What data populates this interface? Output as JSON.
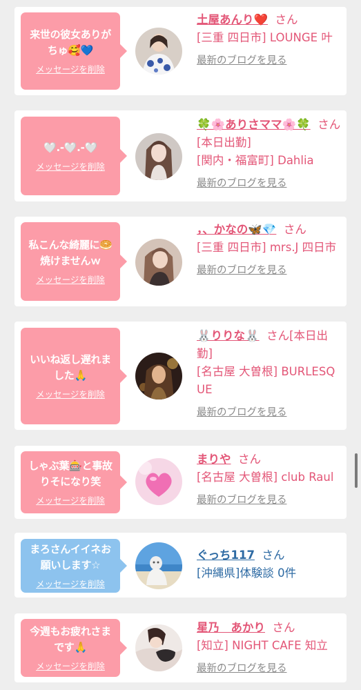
{
  "messages": [
    {
      "bubble": "来世の彼女ありがちゅ🥰💙",
      "delete": "メッセージを削除",
      "name": "土屋あんり❤️",
      "honorific": "さん",
      "shop": "[三重 四日市] LOUNGE 叶",
      "blog": "最新のブログを見る",
      "color": "pink",
      "avatar": "avatar-woman-blue-floral-icon"
    },
    {
      "bubble": "🤍.-🤍.-🤍",
      "delete": "メッセージを削除",
      "name": "🍀🌸ありさママ🌸🍀",
      "honorific": "さん[本日出勤]",
      "shop": "[関内・福富町] Dahlia",
      "blog": "最新のブログを見る",
      "color": "pink",
      "avatar": "avatar-woman-long-hair-icon"
    },
    {
      "bubble": "私こんな綺麗に🥯焼けませんｗ",
      "delete": "メッセージを削除",
      "name": "，、かなの🦋💎",
      "honorific": "さん",
      "shop": "[三重 四日市] mrs.J 四日市",
      "blog": "最新のブログを見る",
      "color": "pink",
      "avatar": "avatar-woman-brown-hair-icon"
    },
    {
      "bubble": "いいね返し遅れました🙏",
      "delete": "メッセージを削除",
      "name": "🐰りりな🐰",
      "honorific": "さん[本日出勤]",
      "shop": "[名古屋 大曽根] BURLESQUE",
      "blog": "最新のブログを見る",
      "color": "pink",
      "avatar": "avatar-woman-gold-light-icon"
    },
    {
      "bubble": "しゃぶ葉🎰と事故りそになり笑",
      "delete": "メッセージを削除",
      "name": "まりや",
      "honorific": "さん",
      "shop": "[名古屋 大曽根] club Raul",
      "blog": "最新のブログを見る",
      "color": "pink",
      "avatar": "avatar-pink-heart-icon"
    },
    {
      "bubble": "まろさんイイネお願いします☆",
      "delete": "メッセージを削除",
      "name": "ぐっち117",
      "honorific": "さん",
      "shop": "[沖縄県]体験談 0件",
      "blog": "",
      "color": "blue",
      "avatar": "avatar-beach-statue-icon"
    },
    {
      "bubble": "今週もお疲れさまです🙏",
      "delete": "メッセージを削除",
      "name": "星乃　あかり",
      "honorific": "さん",
      "shop": "[知立] NIGHT CAFE 知立",
      "blog": "最新のブログを見る",
      "color": "pink",
      "avatar": "avatar-woman-lying-icon"
    }
  ],
  "colors": {
    "bubble_pink": "#fc9ca8",
    "bubble_blue": "#8dc3ee",
    "name_pink": "#e35677",
    "name_blue": "#2d6aa3",
    "blog_gray": "#8a8a8a",
    "background": "#eeeeee"
  }
}
